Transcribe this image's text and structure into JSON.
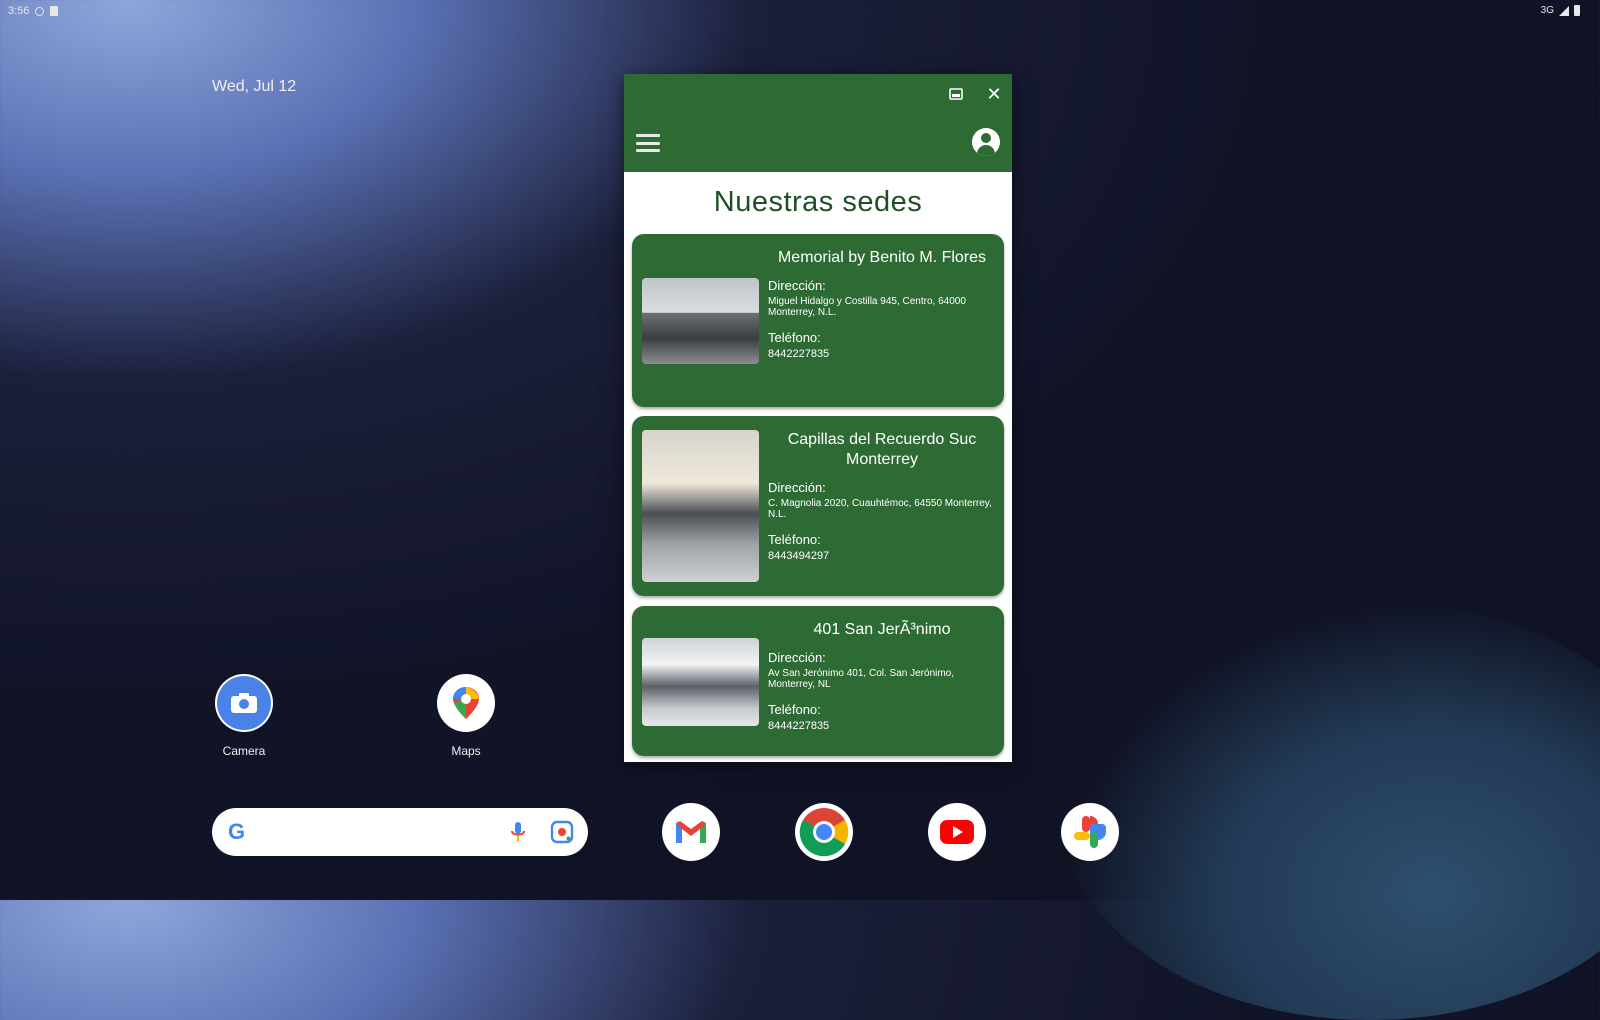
{
  "status_bar": {
    "time": "3:56"
  },
  "home": {
    "date": "Wed, Jul 12"
  },
  "apps": [
    {
      "label": "Camera"
    },
    {
      "label": "Maps"
    }
  ],
  "dock": [
    "Gmail",
    "Chrome",
    "YouTube",
    "Photos"
  ],
  "window": {
    "page_title": "Nuestras sedes",
    "cards": [
      {
        "name": "Memorial by Benito M. Flores",
        "address_label": "Dirección:",
        "address": "Miguel Hidalgo y Costilla 945, Centro, 64000 Monterrey, N.L.",
        "phone_label": "Teléfono:",
        "phone": "8442227835"
      },
      {
        "name": "Capillas del Recuerdo Suc Monterrey",
        "address_label": "Dirección:",
        "address": "C. Magnolia 2020, Cuauhtémoc, 64550 Monterrey, N.L.",
        "phone_label": "Teléfono:",
        "phone": "8443494297"
      },
      {
        "name": "401 San JerÃ³nimo",
        "address_label": "Dirección:",
        "address": "Av San Jerónimo 401, Col. San Jerónimo, Monterrey, NL",
        "phone_label": "Teléfono:",
        "phone": "8444227835"
      }
    ]
  },
  "colors": {
    "app_green": "#2e6b34",
    "title_green": "#1f4f26"
  }
}
